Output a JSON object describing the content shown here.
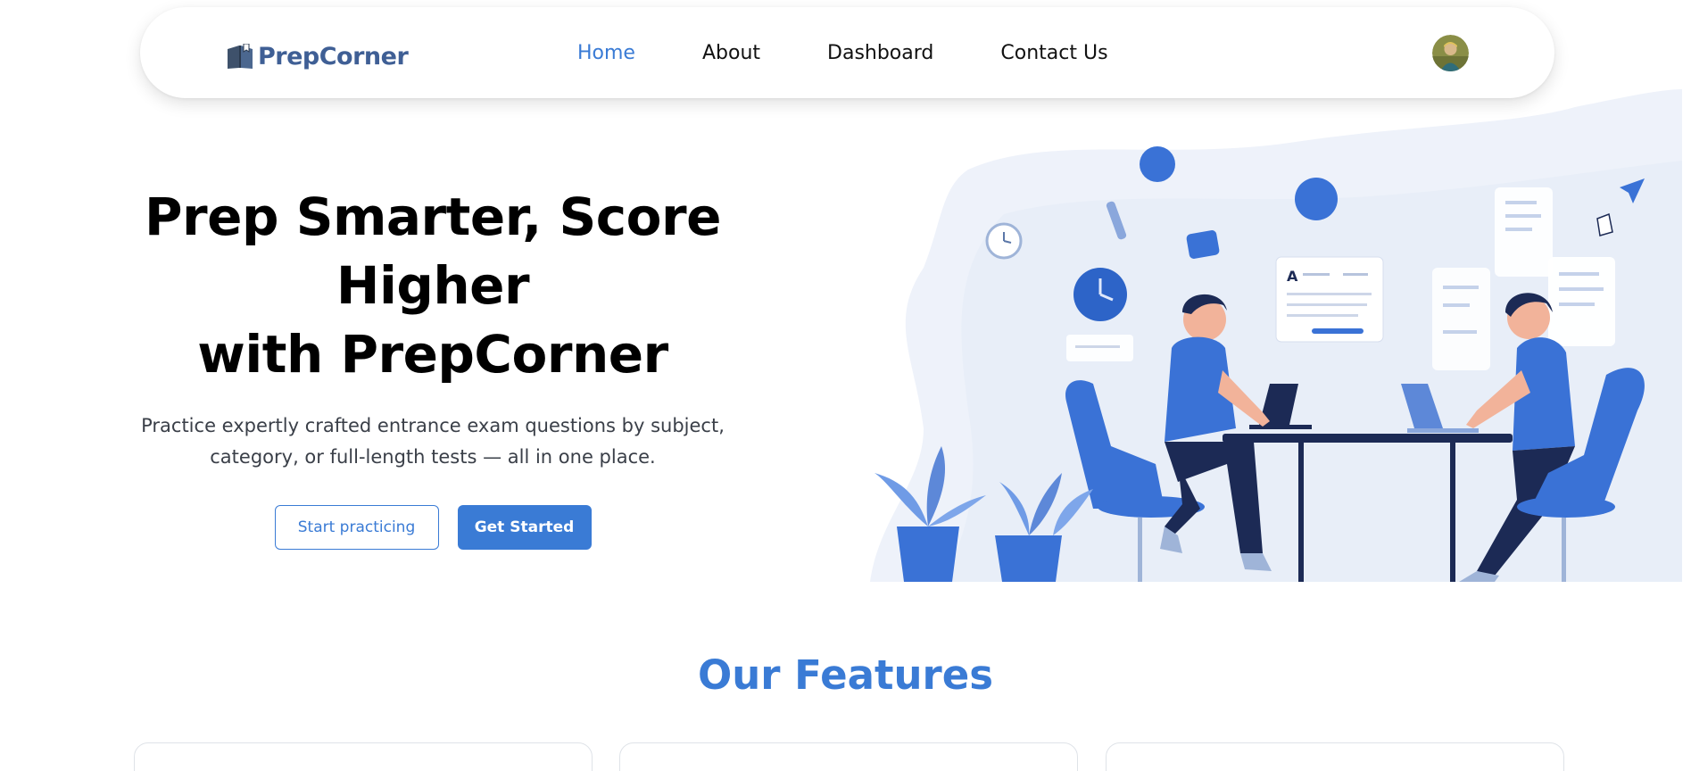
{
  "brand": {
    "name": "PrepCorner",
    "logo_icon": "book-icon"
  },
  "nav": {
    "items": [
      {
        "label": "Home",
        "active": true
      },
      {
        "label": "About",
        "active": false
      },
      {
        "label": "Dashboard",
        "active": false
      },
      {
        "label": "Contact Us",
        "active": false
      }
    ]
  },
  "user": {
    "avatar_icon": "user-avatar"
  },
  "hero": {
    "title_line1": "Prep Smarter, Score Higher",
    "title_line2": "with PrepCorner",
    "subtitle": "Practice expertly crafted entrance exam questions by subject, category, or full-length tests — all in one place.",
    "start_button": "Start practicing",
    "get_started_button": "Get Started",
    "illustration": "students-studying-illustration"
  },
  "features": {
    "title": "Our Features"
  },
  "colors": {
    "accent": "#3a7bd5",
    "brand_text": "#3f5f95",
    "illustration_blue": "#3a72d6",
    "navy": "#1c2a55"
  }
}
